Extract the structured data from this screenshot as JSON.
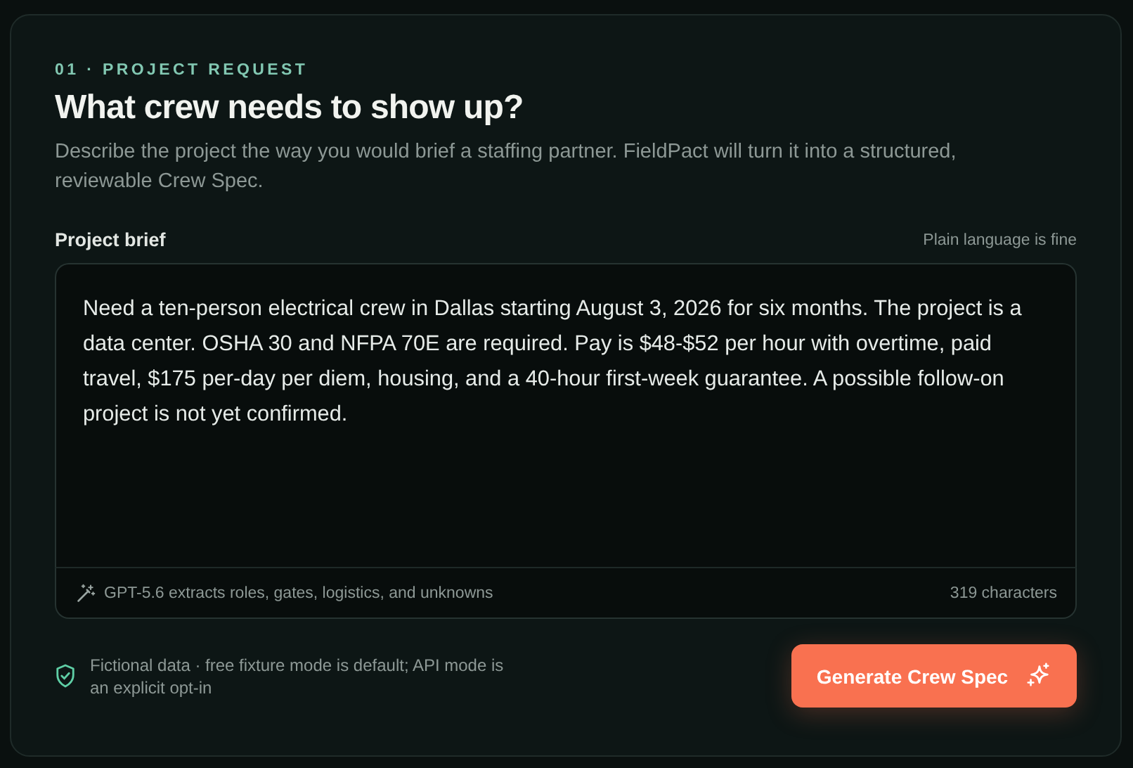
{
  "eyebrow": "01 · PROJECT REQUEST",
  "title": "What crew needs to show up?",
  "description": "Describe the project the way you would brief a staffing partner. FieldPact will turn it into a structured, reviewable Crew Spec.",
  "brief": {
    "label": "Project brief",
    "hint": "Plain language is fine",
    "value": "Need a ten-person electrical crew in Dallas starting August 3, 2026 for six months. The project is a data center. OSHA 30 and NFPA 70E are required. Pay is $48-$52 per hour with overtime, paid travel, $175 per-day per diem, housing, and a 40-hour first-week guarantee. A possible follow-on project is not yet confirmed.",
    "footer_note": "GPT-5.6 extracts roles, gates, logistics, and unknowns",
    "count": "319 characters"
  },
  "notice": "Fictional data · free fixture mode is default; API mode is an explicit opt-in",
  "button": "Generate Crew Spec"
}
